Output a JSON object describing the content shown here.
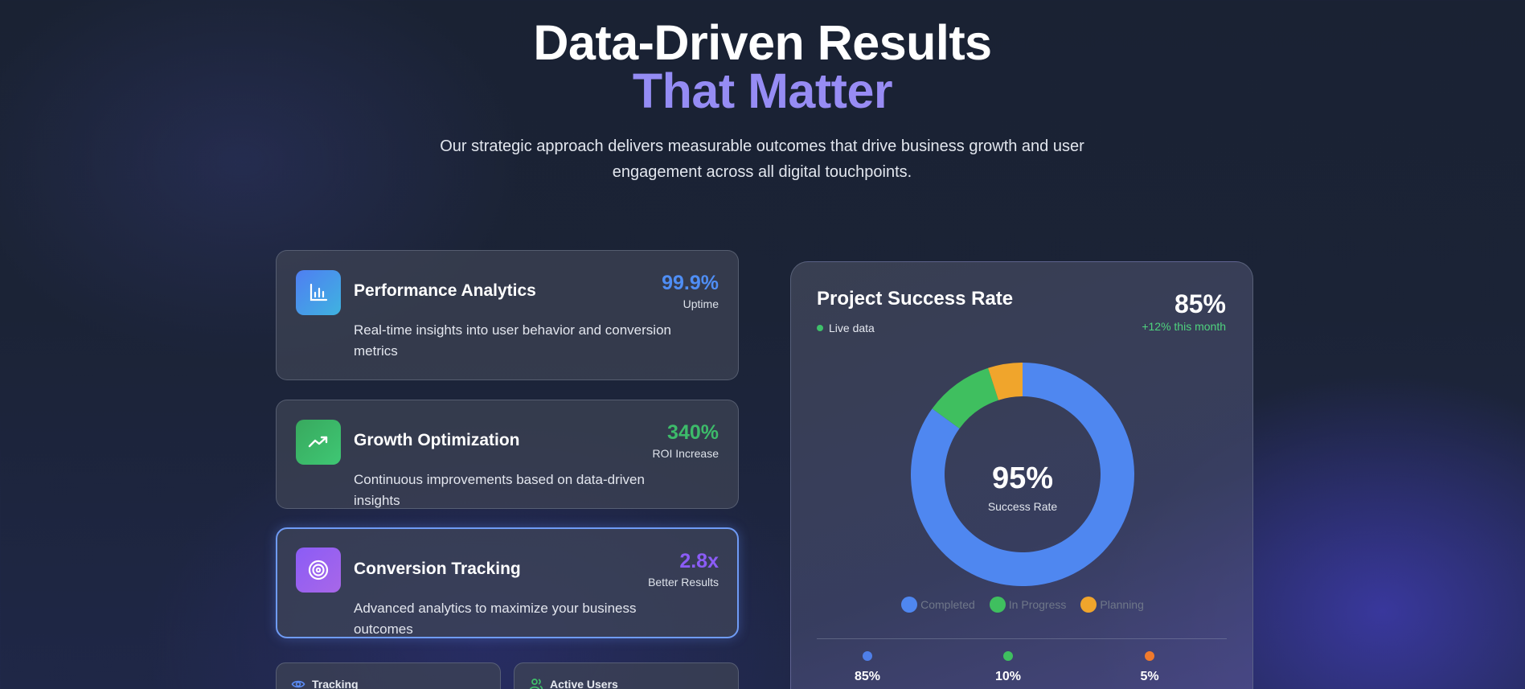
{
  "hero": {
    "title_line1": "Data-Driven Results",
    "title_line2": "That Matter",
    "subtitle": "Our strategic approach delivers measurable outcomes that drive business growth and user engagement across all digital touchpoints."
  },
  "features": [
    {
      "title": "Performance Analytics",
      "description": "Real-time insights into user behavior and conversion metrics",
      "metric": "99.9%",
      "metric_label": "Uptime",
      "metric_color": "#4f8ef5",
      "icon": "bar-chart-icon"
    },
    {
      "title": "Growth Optimization",
      "description": "Continuous improvements based on data-driven insights",
      "metric": "340%",
      "metric_label": "ROI Increase",
      "metric_color": "#3dbb6a",
      "icon": "trending-up-icon"
    },
    {
      "title": "Conversion Tracking",
      "description": "Advanced analytics to maximize your business outcomes",
      "metric": "2.8x",
      "metric_label": "Better Results",
      "metric_color": "#8b5cf6",
      "icon": "target-icon",
      "active": true
    }
  ],
  "mini_cards": [
    {
      "label": "Tracking",
      "icon": "eye-icon"
    },
    {
      "label": "Active Users",
      "icon": "users-icon"
    }
  ],
  "panel": {
    "title": "Project Success Rate",
    "live_label": "Live data",
    "big_value": "85%",
    "change": "+12% this month",
    "center_value": "95%",
    "center_label": "Success Rate",
    "legend": [
      {
        "label": "Completed",
        "color": "#4f87f0"
      },
      {
        "label": "In Progress",
        "color": "#3fbf5f"
      },
      {
        "label": "Planning",
        "color": "#f0a52c"
      }
    ],
    "stats": [
      {
        "value": "85%",
        "color": "#4f7fe8"
      },
      {
        "value": "10%",
        "color": "#3fbf5f"
      },
      {
        "value": "5%",
        "color": "#f07a2c"
      }
    ]
  },
  "chart_data": {
    "type": "pie",
    "categories": [
      "Completed",
      "In Progress",
      "Planning"
    ],
    "values": [
      85,
      10,
      5
    ],
    "colors": [
      "#4f87f0",
      "#3fbf5f",
      "#f0a52c"
    ]
  }
}
